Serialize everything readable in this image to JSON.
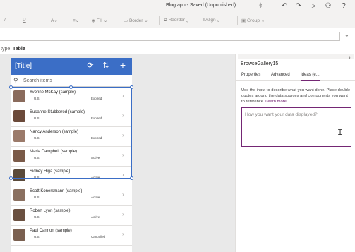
{
  "topbar": {
    "title": "Blog app - Saved (Unpublished)",
    "icons": [
      "stethoscope-icon",
      "undo-icon",
      "redo-icon",
      "play-icon",
      "user-add-icon",
      "help-icon"
    ]
  },
  "ribbon": {
    "fill": "Fill",
    "border": "Border",
    "reorder": "Reorder",
    "align": "Align",
    "group": "Group"
  },
  "typebar": {
    "label": "type",
    "value": "Table"
  },
  "app": {
    "title": "[Title]",
    "search_placeholder": "Search items",
    "accent": "#3b6ec6"
  },
  "gallery": [
    {
      "name": "Yvonne McKay (sample)",
      "country": "U.S.",
      "status": "Expired",
      "avatar_color": "#8a6b5c"
    },
    {
      "name": "Susanne Stubberod (sample)",
      "country": "U.S.",
      "status": "Expired",
      "avatar_color": "#6b4a3a"
    },
    {
      "name": "Nancy Anderson (sample)",
      "country": "U.S.",
      "status": "Expired",
      "avatar_color": "#9b7a6a"
    },
    {
      "name": "Maria Campbell (sample)",
      "country": "U.S.",
      "status": "Active",
      "avatar_color": "#7a5a48"
    },
    {
      "name": "Sidney Higa (sample)",
      "country": "U.S.",
      "status": "Active",
      "avatar_color": "#5a4a3a"
    },
    {
      "name": "Scott Konersmann (sample)",
      "country": "U.S.",
      "status": "Active",
      "avatar_color": "#8a7060"
    },
    {
      "name": "Robert Lyon (sample)",
      "country": "U.S.",
      "status": "Active",
      "avatar_color": "#6a5040"
    },
    {
      "name": "Paul Cannon (sample)",
      "country": "U.S.",
      "status": "Cancelled",
      "avatar_color": "#7a6050"
    }
  ],
  "panel": {
    "control_name": "BrowseGallery15",
    "tabs": [
      "Properties",
      "Advanced",
      "Ideas (e..."
    ],
    "description": "Use the input to describe what you want done. Place double quotes around the data sources and components you want to reference.",
    "learn_more": "Learn more",
    "input_placeholder": "How you want your data displayed?",
    "accent": "#742774"
  }
}
